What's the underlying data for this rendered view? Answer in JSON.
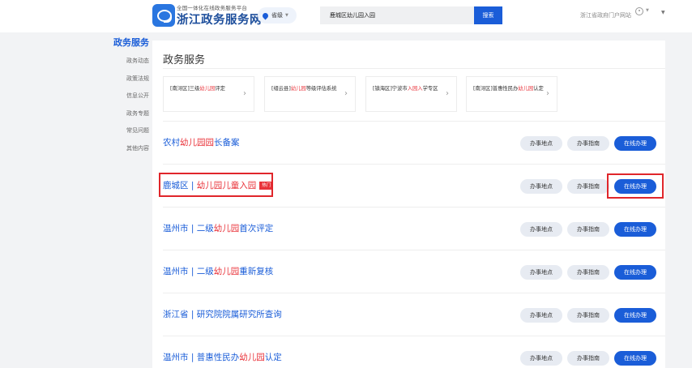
{
  "header": {
    "slogan": "全国一体化在线政务服务平台",
    "site_name": "浙江政务服务网",
    "region": "省级",
    "search_value": "鹿城区幼儿园入园",
    "search_button": "搜索",
    "portal_link": "浙江省政府门户网站"
  },
  "sidebar": {
    "title": "政务服务",
    "items": [
      "政务动态",
      "政策法规",
      "信息公开",
      "政务专题",
      "常见问题",
      "其他内容"
    ]
  },
  "main": {
    "title": "政务服务",
    "related": [
      {
        "pre": "[南浔区]三级",
        "hl": "幼儿园",
        "post": "评定"
      },
      {
        "pre": "[缙云县]",
        "hl": "幼儿园",
        "post": "等级评估系统"
      },
      {
        "pre": "[镇海区]宁波市",
        "hl": "入园入",
        "post": "学专区"
      },
      {
        "pre": "[南浔区]普惠性民办",
        "hl": "幼儿园",
        "post": "认定"
      }
    ],
    "hot_badge": "热门",
    "actions": {
      "location": "办事地点",
      "guide": "办事指南",
      "online": "在线办理"
    },
    "results": [
      {
        "pre": "农村",
        "hl": "幼儿园园",
        "post": "长备案"
      },
      {
        "pre": "鹿城区 | ",
        "hl": "幼儿园儿童入园",
        "post": ""
      },
      {
        "pre": "温州市 | 二级",
        "hl": "幼儿园",
        "post": "首次评定"
      },
      {
        "pre": "温州市 | 二级",
        "hl": "幼儿园",
        "post": "重新复核"
      },
      {
        "pre": "浙江省 | 研究院院属研究所查询",
        "hl": "",
        "post": ""
      },
      {
        "pre": "温州市 | 普惠性民办",
        "hl": "幼儿园",
        "post": "认定"
      }
    ]
  }
}
